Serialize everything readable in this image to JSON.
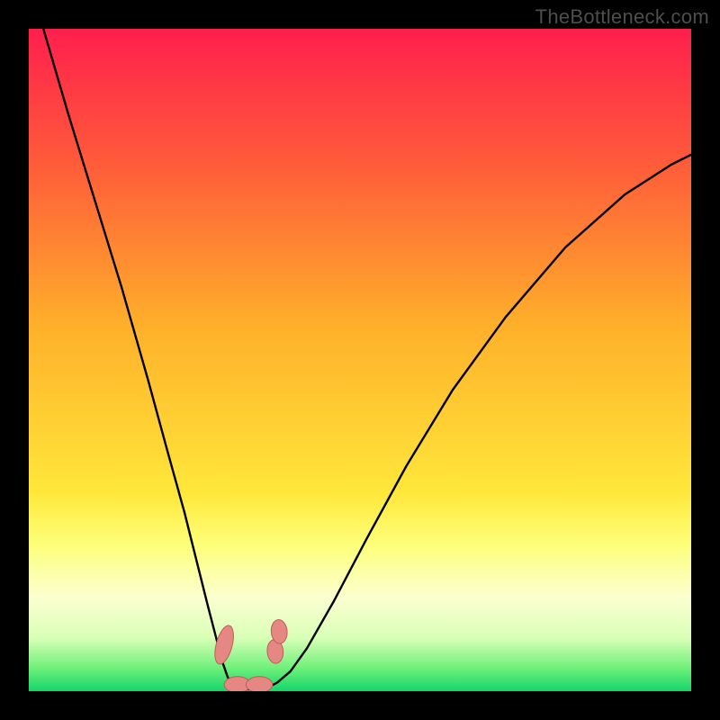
{
  "watermark": "TheBottleneck.com",
  "chart_data": {
    "type": "line",
    "title": "",
    "xlabel": "",
    "ylabel": "",
    "xlim": [
      0,
      1
    ],
    "ylim": [
      0,
      1
    ],
    "gradient_stops": [
      {
        "offset": 0.0,
        "color": "#ff1f4d"
      },
      {
        "offset": 0.2,
        "color": "#ff5a3a"
      },
      {
        "offset": 0.45,
        "color": "#ffb02a"
      },
      {
        "offset": 0.7,
        "color": "#ffe73a"
      },
      {
        "offset": 0.78,
        "color": "#fdff7a"
      },
      {
        "offset": 0.86,
        "color": "#fbffd0"
      },
      {
        "offset": 0.92,
        "color": "#d8ffb6"
      },
      {
        "offset": 0.965,
        "color": "#6ff07b"
      },
      {
        "offset": 1.0,
        "color": "#14d66a"
      }
    ],
    "series": [
      {
        "name": "curve",
        "x": [
          0.022,
          0.06,
          0.1,
          0.14,
          0.18,
          0.21,
          0.235,
          0.255,
          0.27,
          0.283,
          0.292,
          0.3,
          0.306,
          0.31,
          0.32,
          0.345,
          0.36,
          0.375,
          0.395,
          0.42,
          0.46,
          0.51,
          0.57,
          0.64,
          0.72,
          0.81,
          0.9,
          0.97,
          1.0
        ],
        "y": [
          1.0,
          0.87,
          0.74,
          0.61,
          0.47,
          0.36,
          0.27,
          0.19,
          0.13,
          0.08,
          0.045,
          0.022,
          0.01,
          0.005,
          0.003,
          0.003,
          0.005,
          0.013,
          0.03,
          0.065,
          0.135,
          0.23,
          0.34,
          0.455,
          0.565,
          0.67,
          0.75,
          0.795,
          0.81
        ]
      }
    ],
    "markers": [
      {
        "cx": 0.295,
        "cy": 0.07,
        "rx": 0.012,
        "ry": 0.03,
        "rot": 15
      },
      {
        "cx": 0.315,
        "cy": 0.01,
        "rx": 0.02,
        "ry": 0.012,
        "rot": 0
      },
      {
        "cx": 0.348,
        "cy": 0.01,
        "rx": 0.02,
        "ry": 0.012,
        "rot": 0
      },
      {
        "cx": 0.372,
        "cy": 0.06,
        "rx": 0.012,
        "ry": 0.018,
        "rot": -5
      },
      {
        "cx": 0.378,
        "cy": 0.09,
        "rx": 0.012,
        "ry": 0.018,
        "rot": -5
      }
    ],
    "marker_fill": "#e58884",
    "marker_stroke": "#c45a5a"
  }
}
